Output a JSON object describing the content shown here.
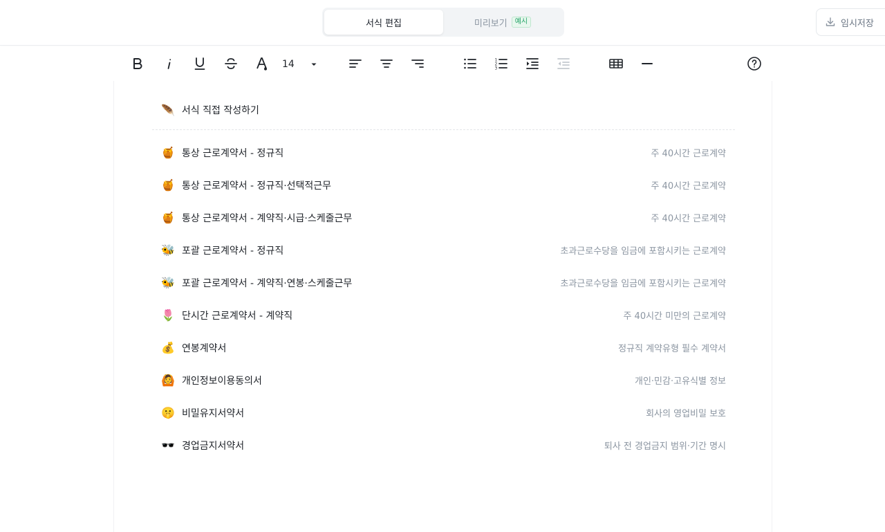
{
  "header": {
    "tabs": [
      {
        "label": "서식 편집",
        "active": true
      },
      {
        "label": "미리보기",
        "badge": "예시",
        "active": false
      }
    ],
    "save_label": "임시저장"
  },
  "toolbar": {
    "font_size": "14",
    "tools": [
      "bold",
      "italic",
      "underline",
      "strikethrough",
      "text-color",
      "font-size",
      "align-left",
      "align-center",
      "align-right",
      "bullet-list",
      "numbered-list",
      "indent",
      "outdent",
      "table",
      "horizontal-rule",
      "help"
    ]
  },
  "document": {
    "direct_write": {
      "emoji": "🪶",
      "label": "서식 직접 작성하기"
    },
    "templates": [
      {
        "emoji": "🍯",
        "title": "통상 근로계약서 - 정규직",
        "desc": "주 40시간 근로계약"
      },
      {
        "emoji": "🍯",
        "title": "통상 근로계약서 - 정규직·선택적근무",
        "desc": "주 40시간 근로계약"
      },
      {
        "emoji": "🍯",
        "title": "통상 근로계약서 - 계약직·시급·스케줄근무",
        "desc": "주 40시간 근로계약"
      },
      {
        "emoji": "🐝",
        "title": "포괄 근로계약서 - 정규직",
        "desc": "초과근로수당을 임금에 포함시키는 근로계약"
      },
      {
        "emoji": "🐝",
        "title": "포괄 근로계약서 - 계약직·연봉·스케줄근무",
        "desc": "초과근로수당을 임금에 포함시키는 근로계약"
      },
      {
        "emoji": "🌷",
        "title": "단시간 근로계약서 - 계약직",
        "desc": "주 40시간 미만의 근로계약"
      },
      {
        "emoji": "💰",
        "title": "연봉계약서",
        "desc": "정규직 계약유형 필수 계약서"
      },
      {
        "emoji": "🙆",
        "title": "개인정보이용동의서",
        "desc": "개인·민감·고유식별 정보"
      },
      {
        "emoji": "🤫",
        "title": "비밀유지서약서",
        "desc": "회사의 영업비밀 보호"
      },
      {
        "emoji": "🕶️",
        "title": "경업금지서약서",
        "desc": "퇴사 전 경업금지 범위·기간 명시"
      }
    ]
  }
}
